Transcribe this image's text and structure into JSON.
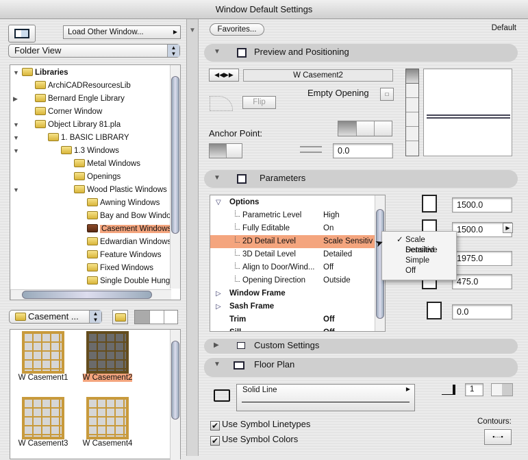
{
  "window": {
    "title": "Window Default Settings"
  },
  "left": {
    "load_other": "Load Other Window...",
    "view_mode": "Folder View",
    "tree": [
      {
        "label": "Libraries",
        "level": 0,
        "toggle": "expanded",
        "bold": true
      },
      {
        "label": "ArchiCADResourcesLib",
        "level": 1,
        "toggle": "none"
      },
      {
        "label": "Bernard Engle Library",
        "level": 1,
        "toggle": "collapsed"
      },
      {
        "label": "Corner Window",
        "level": 1,
        "toggle": "none"
      },
      {
        "label": "Object Library 81.pla",
        "level": 1,
        "toggle": "expanded"
      },
      {
        "label": "1. BASIC LIBRARY",
        "level": 2,
        "toggle": "expanded"
      },
      {
        "label": "1.3 Windows",
        "level": 3,
        "toggle": "expanded"
      },
      {
        "label": "Metal Windows",
        "level": 4,
        "toggle": "none"
      },
      {
        "label": "Openings",
        "level": 4,
        "toggle": "none"
      },
      {
        "label": "Wood Plastic Windows",
        "level": 4,
        "toggle": "expanded"
      },
      {
        "label": "Awning Windows",
        "level": 5,
        "toggle": "none"
      },
      {
        "label": "Bay and Bow Windo",
        "level": 5,
        "toggle": "none"
      },
      {
        "label": "Casement Windows",
        "level": 5,
        "toggle": "none",
        "selected": true
      },
      {
        "label": "Edwardian Windows",
        "level": 5,
        "toggle": "none"
      },
      {
        "label": "Feature Windows",
        "level": 5,
        "toggle": "none"
      },
      {
        "label": "Fixed Windows",
        "level": 5,
        "toggle": "none"
      },
      {
        "label": "Single Double Hung",
        "level": 5,
        "toggle": "none"
      }
    ],
    "folder_popup": "Casement ...",
    "items": [
      {
        "label": "W Casement1",
        "selected": false
      },
      {
        "label": "W Casement2",
        "selected": true
      },
      {
        "label": "W Casement3",
        "selected": false
      },
      {
        "label": "W Casement4",
        "selected": false
      }
    ]
  },
  "right": {
    "favorites": "Favorites...",
    "default_label": "Default",
    "preview": {
      "title": "Preview and Positioning",
      "name": "W Casement2",
      "flip": "Flip",
      "empty_opening": "Empty Opening",
      "anchor_point": "Anchor Point:",
      "offset": "0.0"
    },
    "parameters": {
      "title": "Parameters",
      "rows": [
        {
          "name": "Options",
          "value": "",
          "kind": "group-open"
        },
        {
          "name": "Parametric Level",
          "value": "High",
          "kind": "child"
        },
        {
          "name": "Fully Editable",
          "value": "On",
          "kind": "child"
        },
        {
          "name": "2D Detail Level",
          "value": "Scale Sensitiv",
          "kind": "child",
          "selected": true
        },
        {
          "name": "3D Detail Level",
          "value": "Detailed",
          "kind": "child"
        },
        {
          "name": "Align to Door/Wind...",
          "value": "Off",
          "kind": "child"
        },
        {
          "name": "Opening Direction",
          "value": "Outside",
          "kind": "child"
        },
        {
          "name": "Window Frame",
          "value": "",
          "kind": "group-closed"
        },
        {
          "name": "Sash Frame",
          "value": "",
          "kind": "group-closed"
        },
        {
          "name": "Trim",
          "value": "Off",
          "kind": "bold"
        },
        {
          "name": "Sill",
          "value": "Off",
          "kind": "bold"
        }
      ],
      "dims": [
        "1500.0",
        "1500.0",
        "1975.0",
        "475.0",
        "0.0"
      ],
      "dropdown": {
        "options": [
          "Scale Sensitive",
          "Detailed",
          "Simple",
          "Off"
        ],
        "checked": "Scale Sensitive"
      }
    },
    "custom_settings": "Custom Settings",
    "floor_plan": {
      "title": "Floor Plan",
      "line_type": "Solid Line",
      "pen": "1",
      "use_symbol_linetypes": "Use Symbol Linetypes",
      "use_symbol_colors": "Use Symbol Colors",
      "contours": "Contours:"
    }
  },
  "colors": {
    "selection": "#f4a57e",
    "accent": "#6b8fc4"
  }
}
